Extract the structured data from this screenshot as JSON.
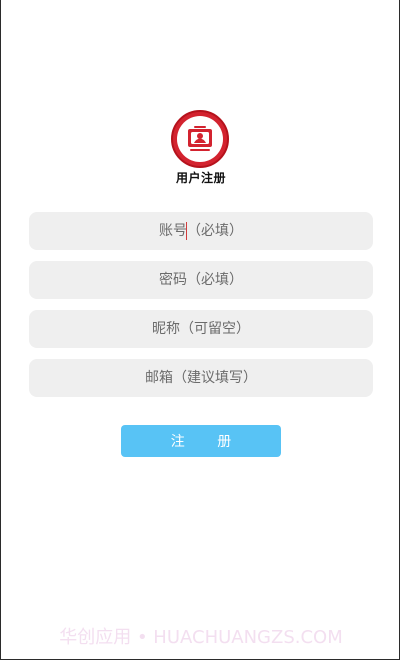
{
  "header": {
    "logo_icon": "user-register-badge-icon",
    "title": "用户注册"
  },
  "form": {
    "account_placeholder": "账号（必填）",
    "password_placeholder": "密码（必填）",
    "nickname_placeholder": "昵称（可留空）",
    "email_placeholder": "邮箱（建议填写）",
    "submit_label": "注 册"
  },
  "watermark": {
    "text": "华创应用 • HUACHUANGZS.COM"
  },
  "colors": {
    "brand_red": "#d3232f",
    "button_blue": "#58c3f5",
    "field_bg": "#efefef",
    "text_dark": "#111111"
  }
}
